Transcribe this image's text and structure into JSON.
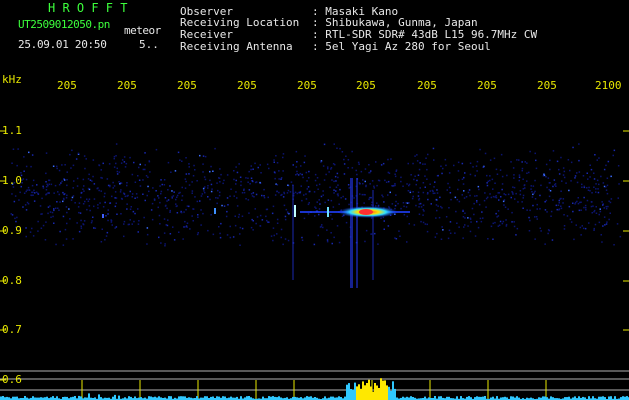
{
  "app": {
    "name": "H R O F F T"
  },
  "file": {
    "name": "UT2509012050.pn",
    "type": "meteor",
    "timestamp": "25.09.01 20:50",
    "suffix": "5.."
  },
  "info": [
    {
      "label": "Observer",
      "value": ": Masaki Kano"
    },
    {
      "label": "Receiving Location",
      "value": ": Shibukawa, Gunma, Japan"
    },
    {
      "label": "Receiver",
      "value": ": RTL-SDR SDR# 43dB L15 96.7MHz CW"
    },
    {
      "label": "Receiving Antenna",
      "value": ": 5el Yagi Az 280 for Seoul"
    }
  ],
  "axis": {
    "unit": "kHz",
    "y_ticks": [
      "1.1",
      "1.0",
      "0.9",
      "0.8",
      "0.7",
      "0.6"
    ],
    "x_ticks": [
      "205",
      "205",
      "205",
      "205",
      "205",
      "205",
      "205",
      "205",
      "205",
      "2100"
    ]
  },
  "colors": {
    "title": "#3cff3c",
    "text": "#e8e8e8",
    "axis": "#e8e800",
    "echo_hot": "#ff3030",
    "echo_mid": "#40e0ff",
    "echo_low": "#2030ff"
  }
}
